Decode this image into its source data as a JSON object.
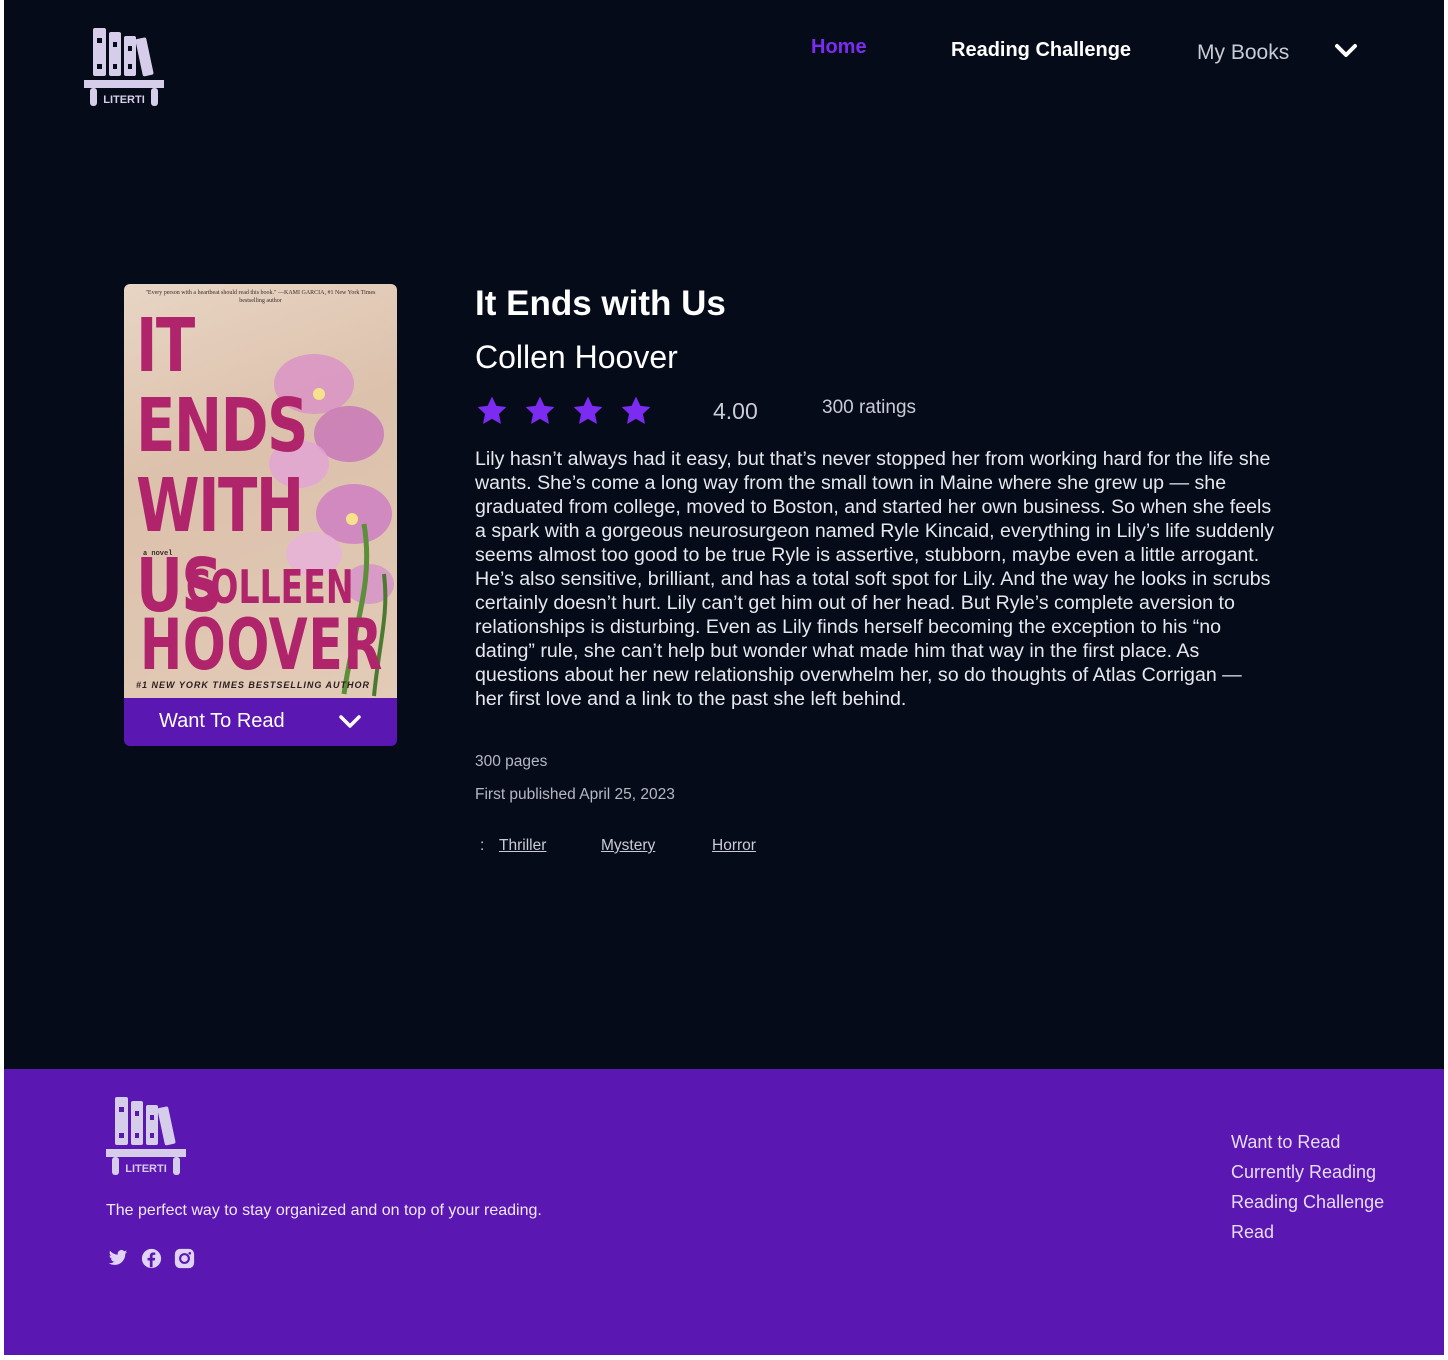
{
  "brand": {
    "name": "LITERTI",
    "colors": {
      "accent": "#7c2cf0",
      "purple": "#5a17b1",
      "background": "#050b18"
    }
  },
  "nav": {
    "home": "Home",
    "reading_challenge": "Reading Challenge",
    "my_books": "My Books",
    "dropdown_icon": "chevron-down-icon"
  },
  "book": {
    "cover": {
      "blurb": "\"Every person with a heartbeat should read this book.\" —KAMI GARCIA, #1 New York Times bestselling author",
      "title_lines": [
        "IT ENDS",
        "WITH",
        "US"
      ],
      "novel_label": "a novel",
      "author_first": "COLLEEN",
      "author_last": "HOOVER",
      "footer": "#1 NEW YORK TIMES BESTSELLING AUTHOR"
    },
    "shelf_button": "Want To Read",
    "title": "It Ends with Us",
    "author": "Collen Hoover",
    "rating_stars": 4,
    "rating_value": "4.00",
    "ratings_count": "300 ratings",
    "description": "Lily hasn’t always had it easy, but that’s never stopped her from working hard for the life she wants. She’s come a long way from the small town in Maine where she grew up — she graduated from college, moved to Boston, and started her own business. So when she feels a spark with a gorgeous neurosurgeon named Ryle Kincaid, everything in Lily’s life suddenly seems almost too good to be true Ryle is assertive, stubborn, maybe even a little arrogant. He’s also sensitive, brilliant, and has a total soft spot for Lily. And the way he looks in scrubs certainly doesn’t hurt. Lily can’t get him out of her head. But Ryle’s complete aversion to relationships is disturbing. Even as Lily finds herself becoming the exception to his “no dating” rule, she can’t help but wonder what made him that way in the first place. As questions about her new relationship overwhelm her, so do thoughts of Atlas Corrigan — her first love and a link to the past she left behind.",
    "pages": "300 pages",
    "first_published": "First published April 25, 2023",
    "genres_prefix": ":",
    "genres": [
      "Thriller",
      "Mystery",
      "Horror"
    ]
  },
  "footer": {
    "tagline": "The perfect way to stay organized and on top of your reading.",
    "social_icons": [
      "twitter-icon",
      "facebook-icon",
      "instagram-icon"
    ],
    "links": [
      "Want to Read",
      "Currently Reading",
      "Reading Challenge",
      "Read"
    ]
  }
}
